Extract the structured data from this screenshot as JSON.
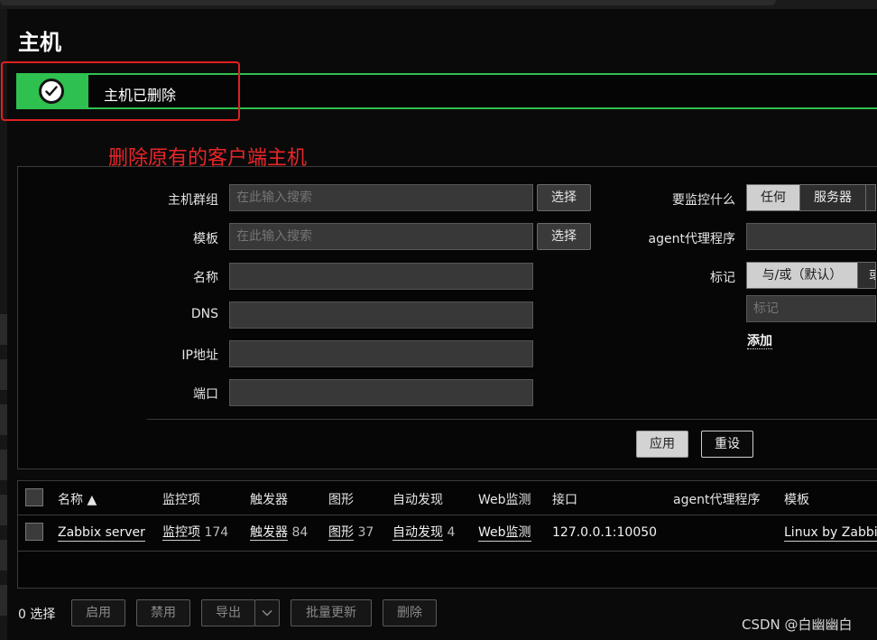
{
  "page": {
    "title": "主机"
  },
  "message": {
    "text": "主机已删除"
  },
  "annotation": {
    "text": "删除原有的客户端主机"
  },
  "filter": {
    "host_groups": {
      "label": "主机群组",
      "placeholder": "在此输入搜索",
      "select": "选择"
    },
    "templates": {
      "label": "模板",
      "placeholder": "在此输入搜索",
      "select": "选择"
    },
    "name": {
      "label": "名称"
    },
    "dns": {
      "label": "DNS"
    },
    "ip": {
      "label": "IP地址"
    },
    "port": {
      "label": "端口"
    },
    "monitored_by": {
      "label": "要监控什么",
      "options": [
        "任何",
        "服务器",
        ""
      ],
      "selected": "任何"
    },
    "proxy": {
      "label": "agent代理程序"
    },
    "tags": {
      "label": "标记",
      "options": [
        "与/或（默认）",
        "或"
      ],
      "selected": "与/或（默认）",
      "tag_placeholder": "标记",
      "add": "添加"
    },
    "apply": "应用",
    "reset": "重设"
  },
  "table": {
    "columns": [
      "名称 ▲",
      "监控项",
      "触发器",
      "图形",
      "自动发现",
      "Web监测",
      "接口",
      "agent代理程序",
      "模板"
    ],
    "rows": [
      {
        "name": "Zabbix server",
        "items_label": "监控项",
        "items_count": "174",
        "triggers_label": "触发器",
        "triggers_count": "84",
        "graphs_label": "图形",
        "graphs_count": "37",
        "discovery_label": "自动发现",
        "discovery_count": "4",
        "web_label": "Web监测",
        "interface": "127.0.0.1:10050",
        "template": "Linux by Zabbix"
      }
    ]
  },
  "actions": {
    "selected_count": "0 选择",
    "enable": "启用",
    "disable": "禁用",
    "export": "导出",
    "mass_update": "批量更新",
    "delete": "删除"
  },
  "watermark": "CSDN @白幽幽白",
  "colors": {
    "success": "#2fc150",
    "annotation": "#e8262a",
    "background": "#0a0a0a"
  }
}
